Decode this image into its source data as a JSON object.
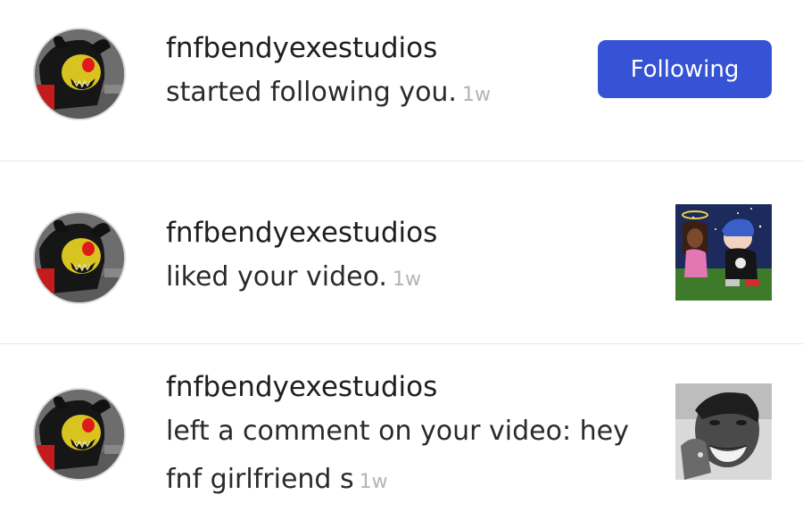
{
  "notifications": [
    {
      "username": "fnfbendyexestudios",
      "message": "started following you.",
      "time": "1w",
      "action_label": "Following",
      "avatar_icon": "bendy-exe-avatar",
      "accent_color": "#3553d4"
    },
    {
      "username": "fnfbendyexestudios",
      "message": "liked your video.",
      "time": "1w",
      "avatar_icon": "bendy-exe-avatar",
      "thumbnail": "video-thumbnail-fnf-characters"
    },
    {
      "username": "fnfbendyexestudios",
      "message_line1": "left a comment on your video: hey",
      "message_line2": "fnf girlfriend s",
      "time": "1w",
      "avatar_icon": "bendy-exe-avatar",
      "thumbnail": "video-thumbnail-face"
    }
  ]
}
